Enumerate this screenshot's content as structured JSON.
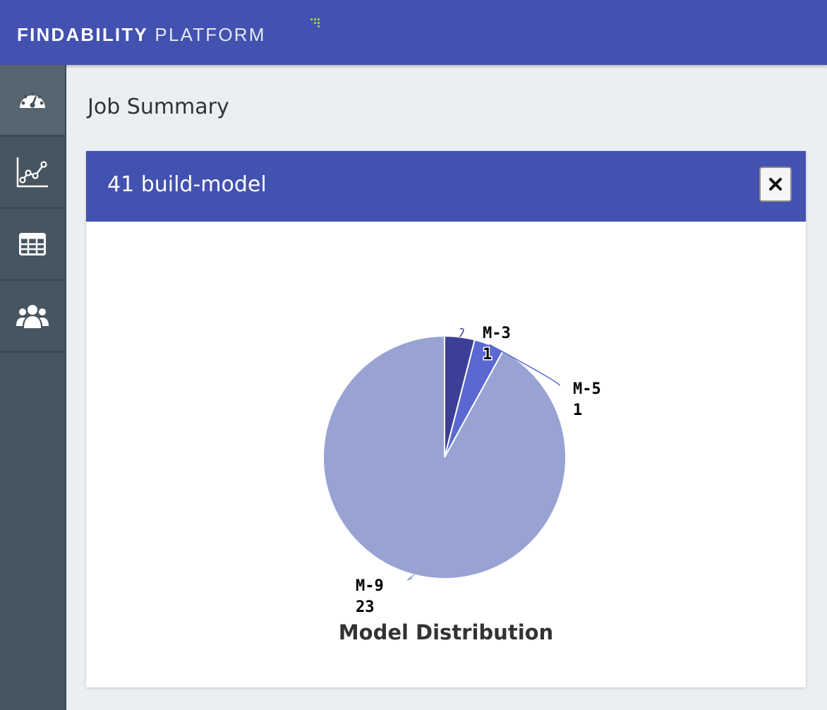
{
  "header": {
    "brand_bold": "FINDABILITY",
    "brand_light": "PLATFORM"
  },
  "sidebar": {
    "items": [
      {
        "name": "dashboard",
        "icon": "dashboard-gauge-icon",
        "active": true
      },
      {
        "name": "analytics",
        "icon": "line-chart-icon",
        "active": false
      },
      {
        "name": "table",
        "icon": "table-icon",
        "active": false
      },
      {
        "name": "users",
        "icon": "users-icon",
        "active": false
      }
    ]
  },
  "page": {
    "title": "Job Summary"
  },
  "card": {
    "title": "41 build-model",
    "close_icon": "close-icon"
  },
  "colors": {
    "header": "#4351b0",
    "sidebar": "#465561",
    "slice_m3": "#3b3f96",
    "slice_m5": "#5b68d1",
    "slice_m9": "#99a3d3"
  },
  "chart_data": {
    "type": "pie",
    "title": "Model Distribution",
    "categories": [
      "M-3",
      "M-5",
      "M-9"
    ],
    "values": [
      1,
      1,
      23
    ]
  }
}
